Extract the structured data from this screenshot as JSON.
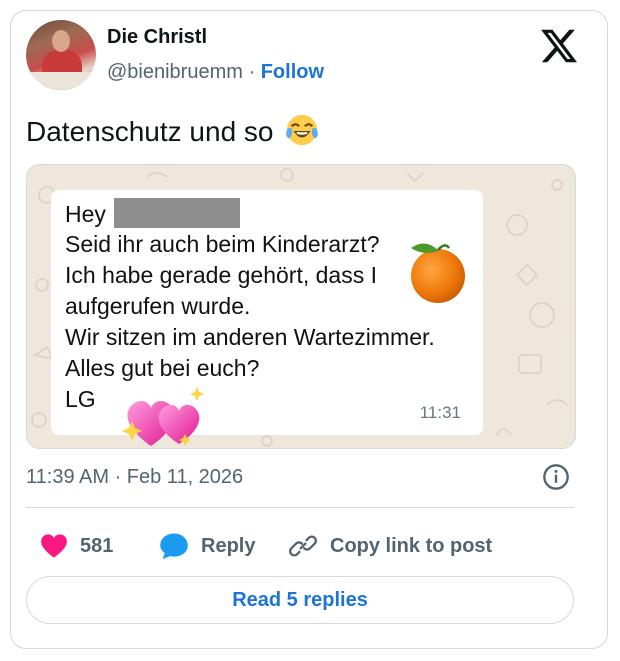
{
  "author": {
    "name": "Die Christl",
    "handle": "@bienibruemm",
    "separator": "·",
    "follow_label": "Follow"
  },
  "post": {
    "text": "Datenschutz und so",
    "emoji": "face-with-tears-of-joy"
  },
  "image": {
    "lines": [
      "Hey",
      "Seid ihr auch beim Kinderarzt?",
      "Ich habe gerade gehört, dass I",
      "aufgerufen wurde.",
      "Wir sitzen im anderen Wartezimmer.",
      "Alles gut bei euch?",
      "LG"
    ],
    "message_time": "11:31",
    "stickers": [
      "tangerine-emoji",
      "sparkling-hearts-emoji"
    ]
  },
  "timestamp": "11:39 AM · Feb 11, 2026",
  "actions": {
    "like_count": "581",
    "reply_label": "Reply",
    "copy_link_label": "Copy link to post"
  },
  "read_replies_label": "Read 5 replies",
  "colors": {
    "accent": "#1d73d8",
    "like": "#f91880",
    "reply_icon": "#1d9bf0",
    "muted": "#536471",
    "chat_background": "#efe7dc"
  }
}
